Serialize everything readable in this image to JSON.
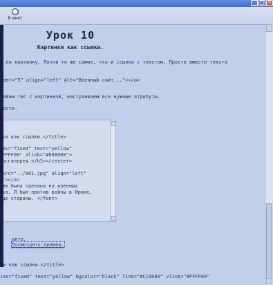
{
  "toolbar": {
    "internet_button": "В инет"
  },
  "titlebar": {
    "min": "_",
    "max": "□",
    "close": "✕"
  },
  "content": {
    "title": "Урок 10",
    "subtitle": "Картинки как ссылки.",
    "lines": [
      "у на картинку. Почти то же самое, что и ссылка с текстом. Просто вместо текста",
      "rder=\"5\" align=\"left\" Alt=\"Военный сайт...\"></a>",
      "тавим тег с картинкой, настраиваем все нужные атрибуты.",
      "росте."
    ],
    "code": [
      "ки как ссылки.</title>",
      "es=\"fixed\" text=\"yellow\"",
      "FFFF00\" alink=\"#008000\">",
      "осгалерея.</h3></center>",
      "",
      "src=\"../001.jpg\" align=\"left\"",
      "\"></a>",
      "ия была сделана на военных",
      "ка. Я был против войны в Ираке,",
      "ще стороны. </font>"
    ],
    "example_text": "акте.",
    "example_link": "Посмотреть пример.",
    "bottom_lines": [
      "ки как ссылки.</title>",
      "ies=\"fixed\" text=\"yellow\" bgcolor=\"black\" link=\"#CC0000\" vlink=\"#FFFF00\""
    ]
  }
}
